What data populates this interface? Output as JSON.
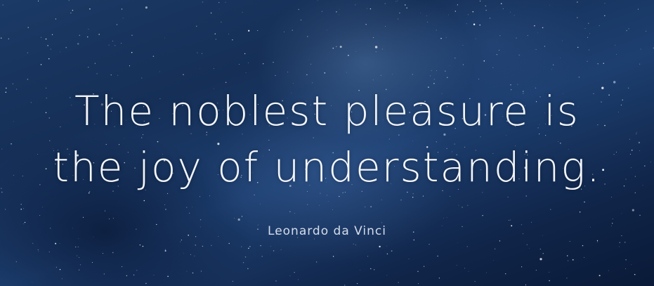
{
  "quote": {
    "line1": "The noblest pleasure is",
    "line2": "the joy of understanding."
  },
  "author": "Leonardo da Vinci",
  "colors": {
    "background": "#152f57",
    "text": "#f3f6fb"
  }
}
